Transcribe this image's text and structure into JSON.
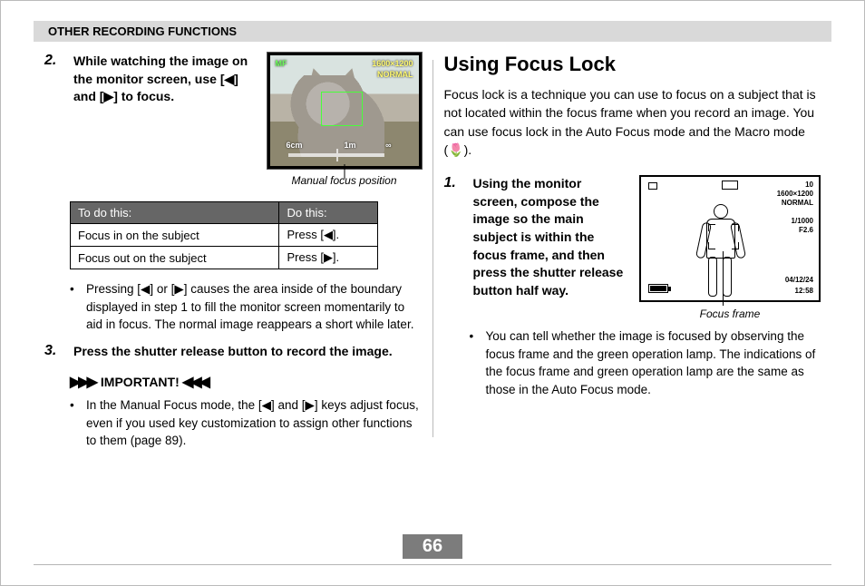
{
  "header": "OTHER RECORDING FUNCTIONS",
  "page_number": "66",
  "left": {
    "step2_num": "2.",
    "step2_text": "While watching the image on the monitor screen, use [◀] and [▶] to focus.",
    "photo_caption": "Manual focus position",
    "osd": {
      "mf": "MF",
      "res": "1600×1200",
      "quality": "NORMAL",
      "near": "6cm",
      "far": "1m",
      "inf": "∞"
    },
    "table": {
      "h1": "To do this:",
      "h2": "Do this:",
      "rows": [
        {
          "a": "Focus in on the subject",
          "b": "Press [◀]."
        },
        {
          "a": "Focus out on the subject",
          "b": "Press [▶]."
        }
      ]
    },
    "bullet1": "Pressing [◀] or [▶] causes the area inside of the boundary displayed in step 1 to fill the monitor screen momentarily to aid in focus. The normal image reappears a short while later.",
    "step3_num": "3.",
    "step3_text": "Press the shutter release button to record the image.",
    "important_label": "IMPORTANT!",
    "important_bullet": "In the Manual Focus mode, the [◀] and [▶] keys adjust focus, even if you used key customization to assign other functions to them (page 89)."
  },
  "right": {
    "heading": "Using Focus Lock",
    "intro": "Focus lock is a technique you can use to focus on a subject that is not located within the focus frame when you record an image. You can use focus lock in the Auto Focus mode and the Macro mode (🌷).",
    "step1_num": "1.",
    "step1_text": "Using the monitor screen, compose the image so the main subject is within the focus frame, and then press the shutter release button half way.",
    "lcd_caption": "Focus frame",
    "lcd": {
      "count": "10",
      "res": "1600×1200",
      "quality": "NORMAL",
      "shutter": "1/1000",
      "fnum": "F2.6",
      "date": "04/12/24",
      "time": "12:58"
    },
    "bullet1": "You can tell whether the image is focused by observing the focus frame and the green operation lamp. The indications of the focus frame and green operation lamp are the same as those in the Auto Focus mode."
  }
}
